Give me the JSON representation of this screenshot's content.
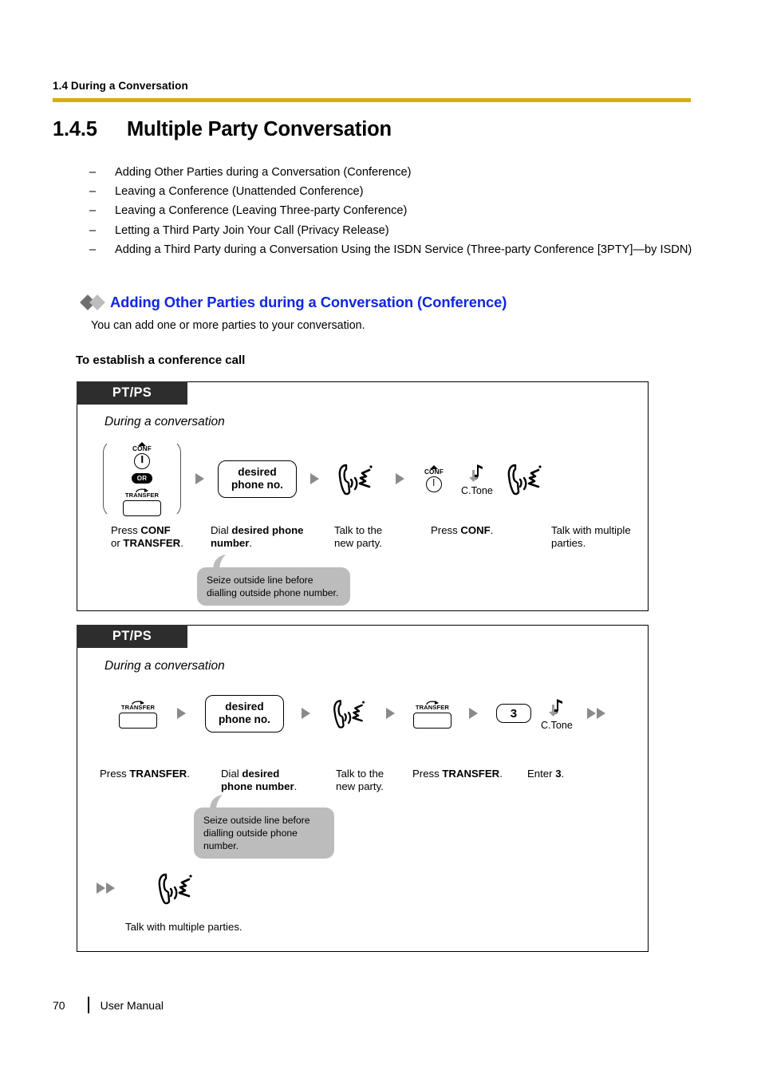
{
  "running_head": "1.4 During a Conversation",
  "rule_color": "#d7ad0c",
  "chapter": {
    "number": "1.4.5",
    "title": "Multiple Party Conversation"
  },
  "topic_list": [
    {
      "mark": "–",
      "text": "Adding Other Parties during a Conversation (Conference)"
    },
    {
      "mark": "–",
      "text": "Leaving a Conference (Unattended Conference)"
    },
    {
      "mark": "–",
      "text": "Leaving a Conference (Leaving Three-party Conference)"
    },
    {
      "mark": "–",
      "text": "Letting a Third Party Join Your Call (Privacy Release)"
    },
    {
      "mark": "–",
      "text": "Adding a Third Party during a Conversation Using the ISDN Service (Three-party Conference [3PTY]—by ISDN)"
    }
  ],
  "section": {
    "heading": "Adding Other Parties during a Conversation (Conference)",
    "heading_color": "#1126e0",
    "intro": "You can add one or more parties to your conversation.",
    "subheading": "To establish a conference call"
  },
  "box1": {
    "badge": "PT/PS",
    "state": "During a conversation",
    "keys": {
      "conf_label": "CONF",
      "or_label": "OR",
      "transfer_label": "TRANSFER"
    },
    "display_box": {
      "line1": "desired",
      "line2": "phone no."
    },
    "conf_label2": "CONF",
    "tone_label": "C.Tone",
    "captions": [
      {
        "line1": "Press ",
        "bold1": "CONF",
        "line2": "or ",
        "bold2": "TRANSFER",
        "tail": "."
      },
      {
        "line1": "Dial ",
        "bold1": "desired phone",
        "bold2": "number",
        "tail": "."
      },
      {
        "line1": "Talk to the",
        "line2": "new party."
      },
      {
        "line1": "Press ",
        "bold1": "CONF",
        "tail": "."
      },
      {
        "line1": "Talk with multiple",
        "line2": "parties."
      }
    ],
    "caption_1a": "Press ",
    "caption_1a_b": "CONF",
    "caption_1b": "or ",
    "caption_1b_b": "TRANSFER",
    "caption_2a": "Dial ",
    "caption_2a_b": "desired phone",
    "caption_2b_b": "number",
    "caption_3a": "Talk to the",
    "caption_3b": "new party.",
    "caption_4a": "Press ",
    "caption_4a_b": "CONF",
    "caption_5a": "Talk with multiple",
    "caption_5b": "parties.",
    "callout": {
      "line1": "Seize outside line before",
      "line2": "dialling outside phone number."
    }
  },
  "box2": {
    "badge": "PT/PS",
    "state": "During a conversation",
    "keys": {
      "transfer_label": "TRANSFER"
    },
    "display_box": {
      "line1": "desired",
      "line2": "phone no."
    },
    "digit": "3",
    "tone_label": "C.Tone",
    "caption_1a": "Press ",
    "caption_1a_b": "TRANSFER",
    "caption_2a": "Dial ",
    "caption_2a_b": "desired",
    "caption_2b_b": "phone number",
    "caption_3a": "Talk to the",
    "caption_3b": "new party.",
    "caption_4a": "Press ",
    "caption_4a_b": "TRANSFER",
    "caption_5a": "Enter ",
    "caption_5a_b": "3",
    "caption_6": "Talk with multiple parties.",
    "callout": {
      "line1": "Seize outside line before",
      "line2": "dialling outside phone number."
    }
  },
  "footer": {
    "page": "70",
    "label": "User Manual"
  }
}
